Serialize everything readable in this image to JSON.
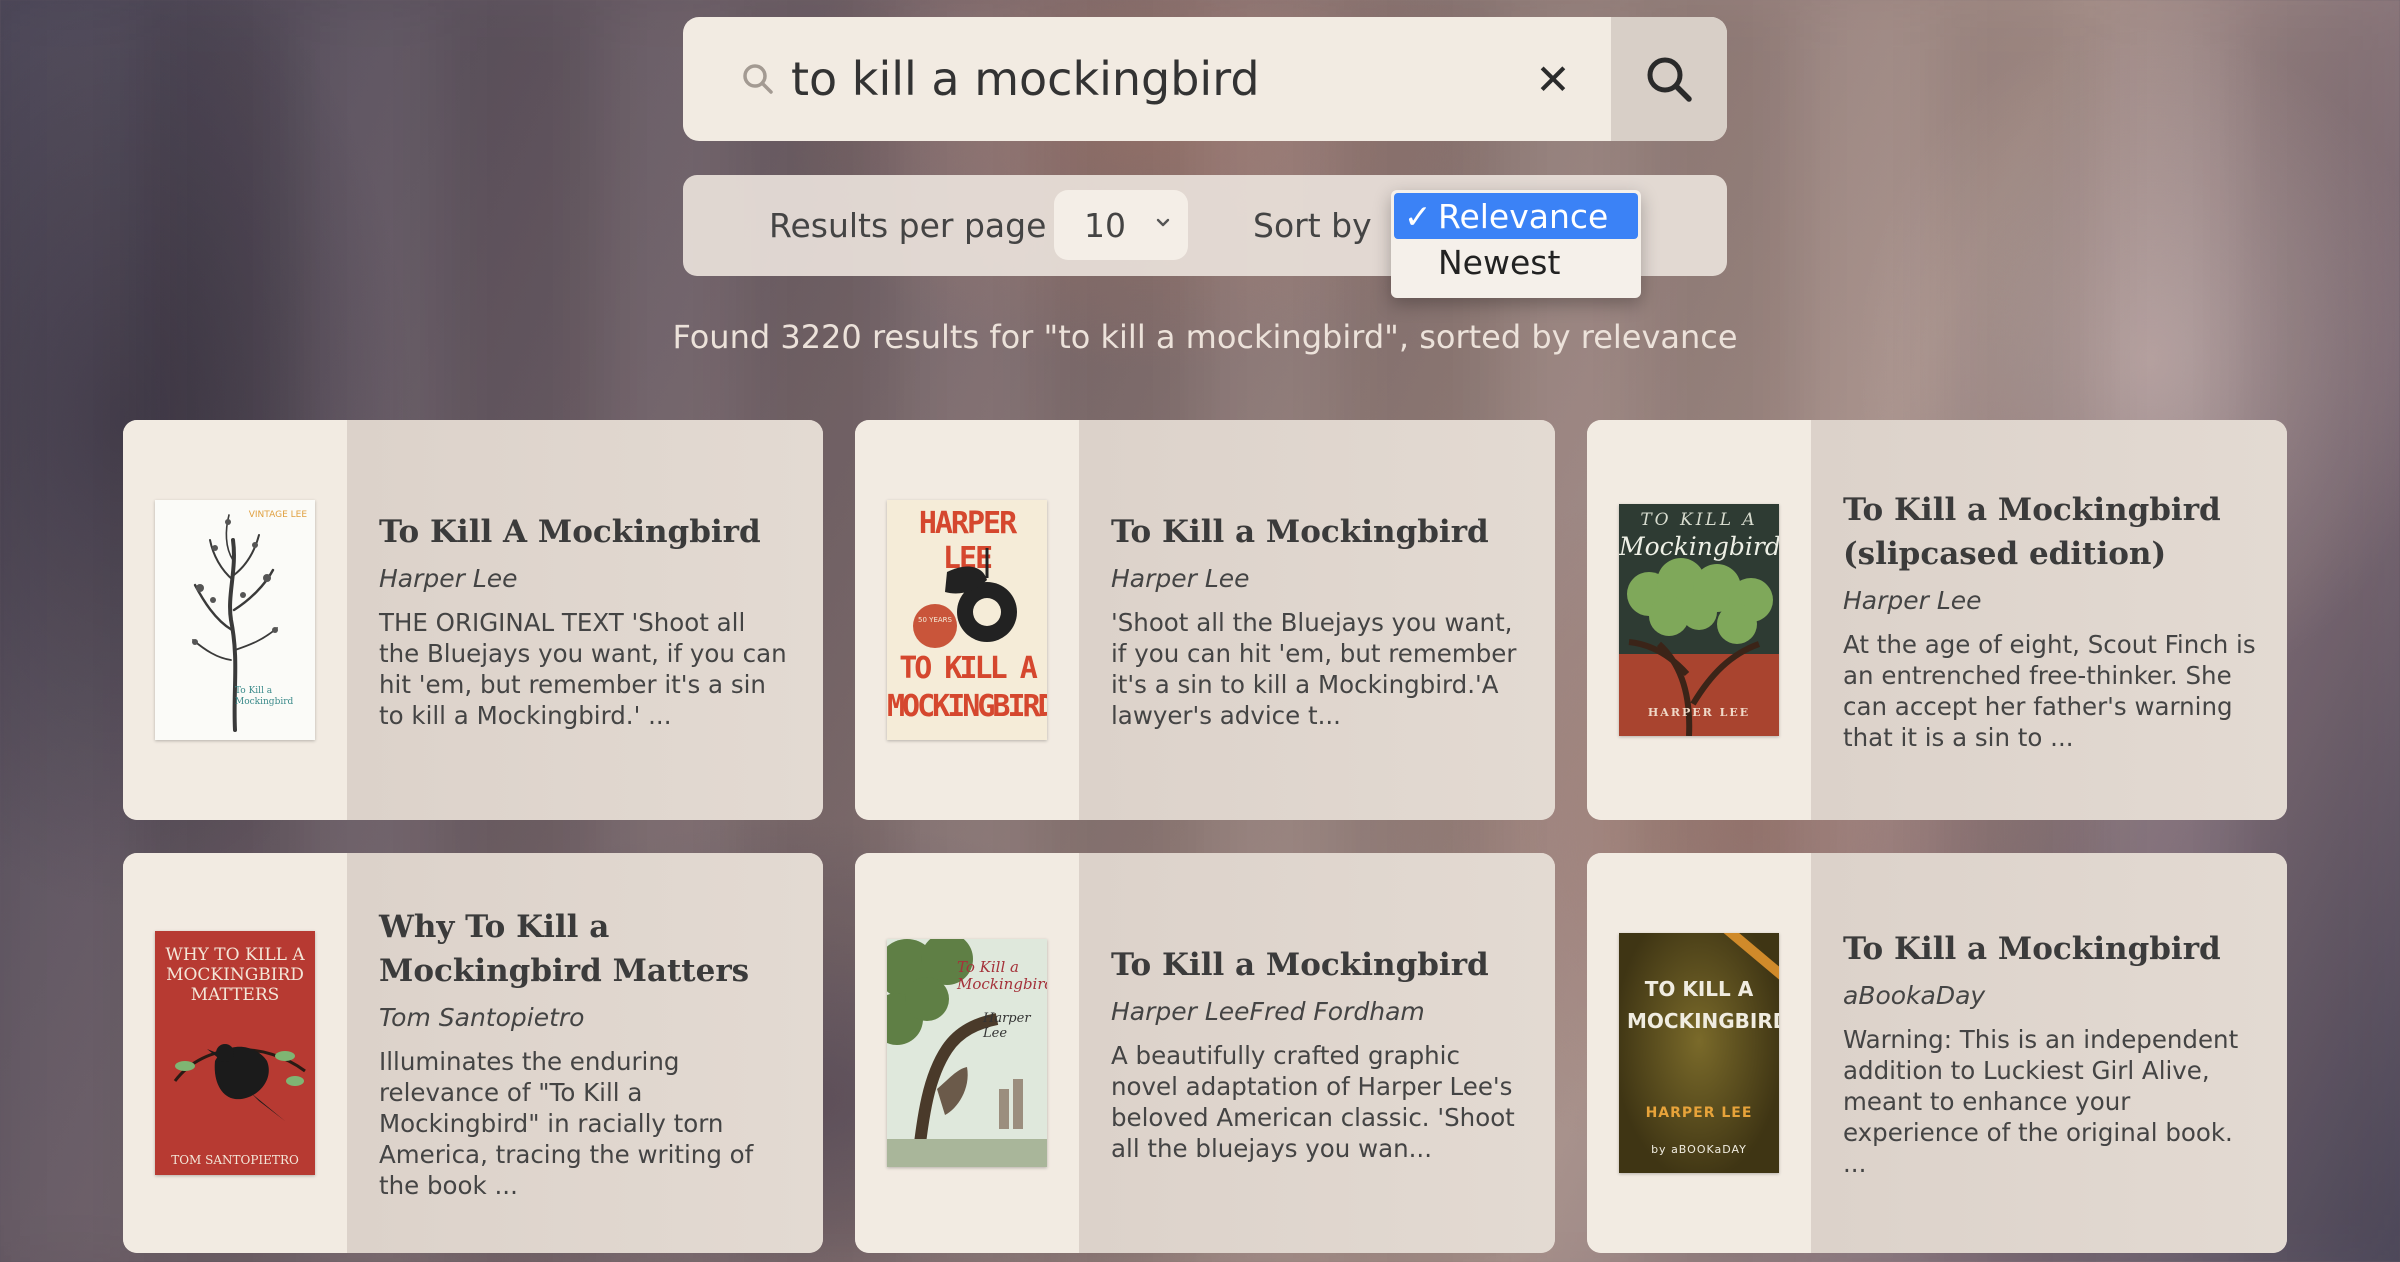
{
  "search": {
    "query": "to kill a mockingbird",
    "clear_symbol": "✕"
  },
  "controls": {
    "results_per_page_label": "Results per page",
    "results_per_page_value": "10",
    "sort_label": "Sort by",
    "sort_options": [
      {
        "label": "Relevance",
        "selected": true,
        "check": "✓"
      },
      {
        "label": "Newest",
        "selected": false,
        "check": ""
      }
    ]
  },
  "summary": "Found 3220 results for \"to kill a mockingbird\", sorted by relevance",
  "books": [
    {
      "title": "To Kill A Mockingbird",
      "author": "Harper Lee",
      "description": "THE ORIGINAL TEXT 'Shoot all the Bluejays you want, if you can hit 'em, but remember it's a sin to kill a Mockingbird.' ...",
      "cover": {
        "style": "white-tree",
        "top_text": "VINTAGE LEE",
        "bottom_text": "To Kill a Mockingbird"
      }
    },
    {
      "title": "To Kill a Mockingbird",
      "author": "Harper Lee",
      "description": "'Shoot all the Bluejays you want, if you can hit 'em, but remember it's a sin to kill a Mockingbird.'A lawyer's advice t...",
      "cover": {
        "style": "tire-swing",
        "top_text": "HARPER LEE",
        "bottom_text": "TO KILL A MOCKINGBIRD"
      }
    },
    {
      "title": "To Kill a Mockingbird (slipcased edition)",
      "author": "Harper Lee",
      "description": "At the age of eight, Scout Finch is an entrenched free-thinker. She can accept her father's warning that it is a sin to ...",
      "cover": {
        "style": "green-tree",
        "top_text": "TO KILL A",
        "mid_text": "Mockingbird",
        "bottom_text": "HARPER LEE"
      }
    },
    {
      "title": "Why To Kill a Mockingbird Matters",
      "author": "Tom Santopietro",
      "description": "Illuminates the enduring relevance of \"To Kill a Mockingbird\" in racially torn America, tracing the writing of the book ...",
      "cover": {
        "style": "red-bird",
        "top_text": "WHY TO KILL A MOCKINGBIRD MATTERS",
        "bottom_text": "TOM SANTOPIETRO"
      }
    },
    {
      "title": "To Kill a Mockingbird",
      "author": "Harper LeeFred Fordham",
      "description": "A beautifully crafted graphic novel adaptation of Harper Lee's beloved American classic. 'Shoot all the bluejays you wan...",
      "cover": {
        "style": "graphic-novel",
        "top_text": "To Kill a Mockingbird",
        "bottom_text": "Harper Lee"
      }
    },
    {
      "title": "To Kill a Mockingbird",
      "author": "aBookaDay",
      "description": "Warning: This is an independent addition to Luckiest Girl Alive, meant to enhance your experience of the original book. ...",
      "cover": {
        "style": "olive",
        "top_text": "TO KILL A MOCKINGBIRD",
        "mid_text": "HARPER LEE",
        "bottom_text": "by aBOOKaDAY"
      }
    }
  ]
}
